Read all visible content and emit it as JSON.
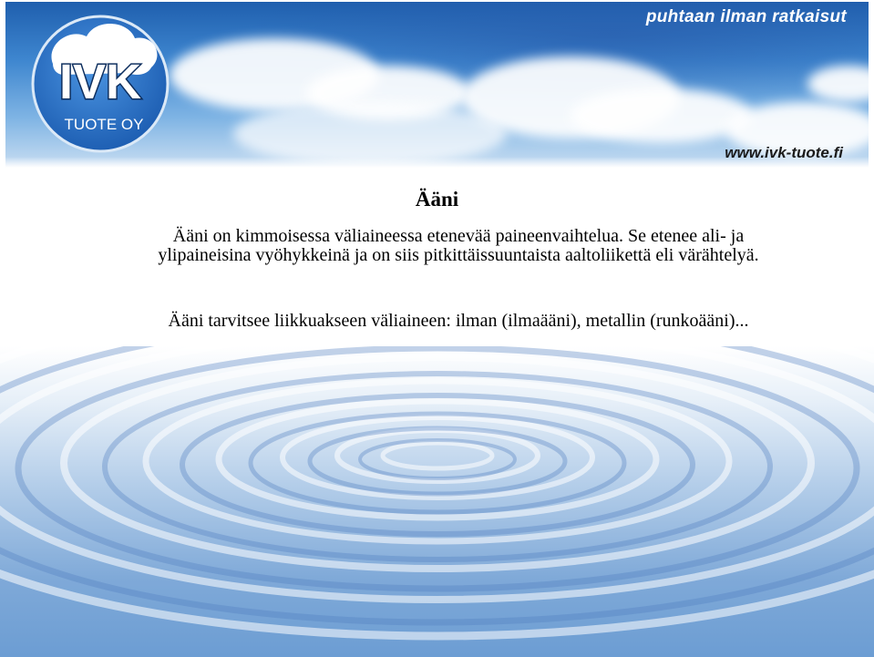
{
  "header": {
    "slogan": "puhtaan ilman ratkaisut",
    "website": "www.ivk-tuote.fi",
    "logo": {
      "brand": "IVK",
      "sub": "TUOTE OY"
    }
  },
  "slide": {
    "title": "Ääni",
    "paragraphs": [
      "Ääni on kimmoisessa väliaineessa etenevää paineenvaihtelua. Se etenee ali- ja ylipaineisina vyöhykkeinä ja on siis pitkittäissuuntaista aaltoliikettä eli värähtelyä.",
      "Ääni tarvitsee liikkuakseen väliaineen: ilman (ilmaääni), metallin (runkoääni)..."
    ]
  },
  "colors": {
    "sky_dark": "#1f5fae",
    "logo_blue": "#2a72c9",
    "water_blue": "#6c9dd3"
  }
}
